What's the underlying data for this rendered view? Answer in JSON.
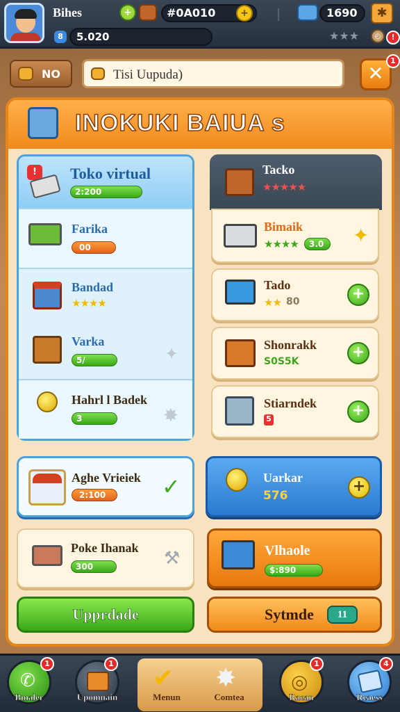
{
  "topbar": {
    "player_name": "Bihes",
    "xp_value": "5.020",
    "xp_prefix": "8",
    "coins": "#0A010",
    "gems": "1690",
    "stars": "★★★"
  },
  "search": {
    "left_button": "NO",
    "value": "Tisi Uupuda)",
    "close": "✕",
    "close_badge": "1"
  },
  "panel": {
    "title": "INOKUKI BAIUA s"
  },
  "left_column": {
    "header": {
      "title": "Toko virtual",
      "value": "2:200"
    },
    "items": [
      {
        "title": "Farika",
        "value": "00"
      },
      {
        "title": "Bandad",
        "stars": "★★★★"
      },
      {
        "title": "Varka",
        "value": "5/"
      },
      {
        "title": "Hahrl l Badek",
        "value": "3"
      }
    ]
  },
  "right_column": {
    "header": {
      "title": "Tacko",
      "stars": "★★★★★"
    },
    "items": [
      {
        "title": "Bimaik",
        "stars": "★★★★",
        "value": "3.0"
      },
      {
        "title": "Tado",
        "stars": "★★",
        "value": "80"
      },
      {
        "title": "Shonrakk",
        "value": "S0S5K"
      },
      {
        "title": "Stiarndek",
        "value": "5"
      }
    ]
  },
  "wide_cards": [
    {
      "title": "Aghe Vrieiek",
      "value": "2:100"
    },
    {
      "title": "Uarkar",
      "value": "576"
    },
    {
      "title": "Poke Ihanak",
      "value": "300"
    },
    {
      "title": "Vlhaole",
      "value": "$:890"
    }
  ],
  "buttons": {
    "upgrade": "Upprdade",
    "system": "Sytmde",
    "system_value": "11"
  },
  "bottom_nav": [
    {
      "label": "Bmaler",
      "badge": "1"
    },
    {
      "label": "Upomnain",
      "badge": "1"
    },
    {
      "label": "Menun",
      "badge": ""
    },
    {
      "label": "Comtea",
      "badge": ""
    },
    {
      "label": "Raean",
      "badge": "1"
    },
    {
      "label": "Reaess",
      "badge": "4"
    }
  ],
  "colors": {
    "accent_orange": "#f08a1c",
    "accent_blue": "#4aa2e0",
    "accent_green": "#3aa81a"
  }
}
